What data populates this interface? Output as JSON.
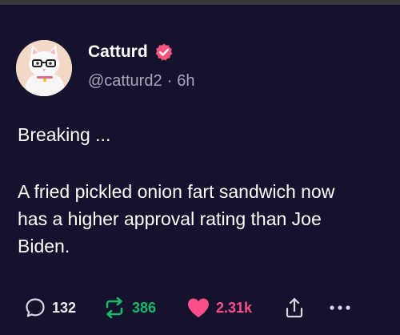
{
  "author": {
    "display_name": "Catturd",
    "handle": "@catturd2",
    "separator": "·",
    "time": "6h",
    "verified": true
  },
  "post": {
    "line1": "Breaking ...",
    "paragraph": [
      "A fried pickled onion fart sandwich now",
      "has a higher approval rating than Joe",
      "Biden."
    ]
  },
  "actions": {
    "replies": "132",
    "reposts": "386",
    "likes": "2.31k",
    "icons": {
      "reply": "chat-bubble-icon",
      "repost": "repost-arrows-icon",
      "like": "heart-icon",
      "share": "share-icon",
      "more": "more-dots-icon"
    }
  },
  "colors": {
    "background": "#15122d",
    "repost": "#18b86a",
    "like": "#ff4f8b",
    "verified_badge": "#f7567c",
    "muted_text": "#a7a5b8"
  }
}
